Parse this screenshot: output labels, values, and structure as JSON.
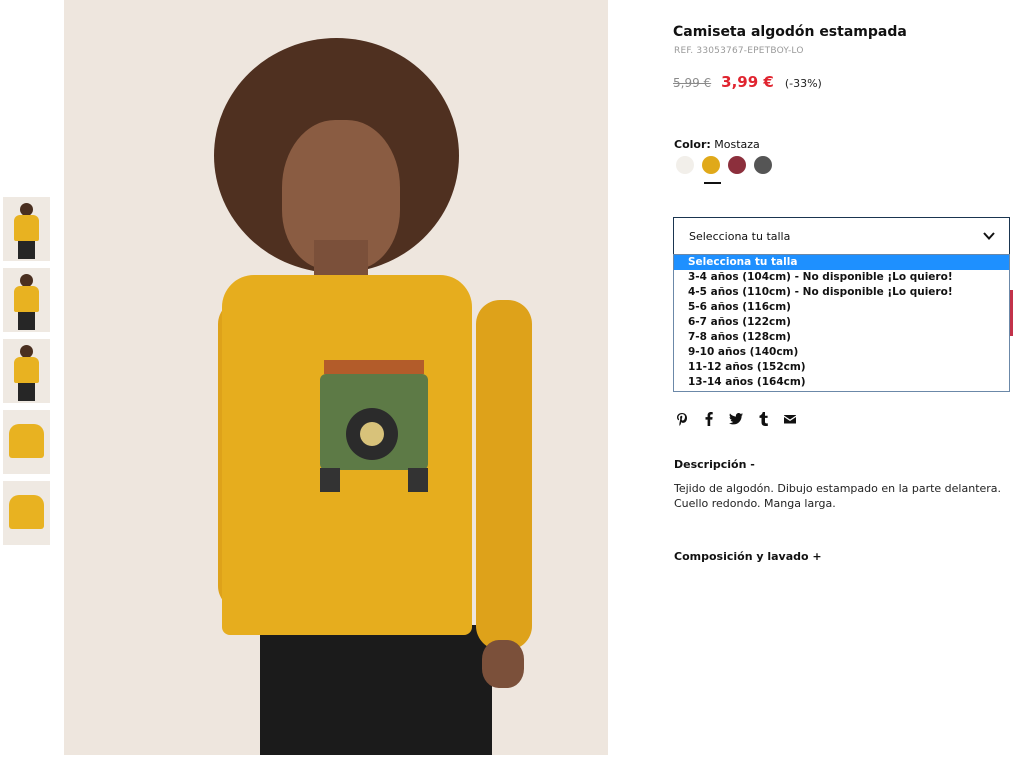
{
  "product": {
    "title": "Camiseta algodón estampada",
    "ref": "REF. 33053767-EPETBOY-LO",
    "old_price": "5,99 €",
    "new_price": "3,99 €",
    "discount": "(-33%)"
  },
  "color": {
    "label": "Color:",
    "selected": "Mostaza",
    "swatches": [
      {
        "name": "Crudo",
        "hex": "#f2efea"
      },
      {
        "name": "Mostaza",
        "hex": "#e0a91a"
      },
      {
        "name": "Granate",
        "hex": "#8c2f3c"
      },
      {
        "name": "Gris",
        "hex": "#555555"
      }
    ]
  },
  "size": {
    "selected": "Selecciona tu talla",
    "options": [
      "Selecciona tu talla",
      "3-4 años (104cm) - No disponible ¡Lo quiero!",
      "4-5 años (110cm) - No disponible ¡Lo quiero!",
      "5-6 años (116cm)",
      "6-7 años (122cm)",
      "7-8 años (128cm)",
      "9-10 años (140cm)",
      "11-12 años (152cm)",
      "13-14 años (164cm)"
    ]
  },
  "share_icons": [
    "pinterest-icon",
    "facebook-icon",
    "twitter-icon",
    "tumblr-icon",
    "email-icon"
  ],
  "description": {
    "title": "Descripción -",
    "text": "Tejido de algodón. Dibujo estampado en la parte delantera. Cuello redondo. Manga larga."
  },
  "composition": {
    "title": "Composición y lavado +"
  },
  "colors": {
    "sale_red": "#e0242f",
    "select_border": "#1a3550",
    "highlight": "#1e90ff"
  }
}
